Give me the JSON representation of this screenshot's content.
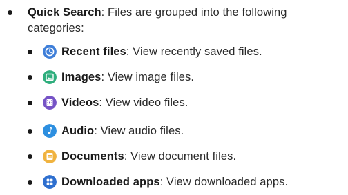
{
  "intro": {
    "title": "Quick Search",
    "line1_rest": ": Files are grouped into the following",
    "line2": "categories:"
  },
  "items": [
    {
      "label": "Recent files",
      "desc": ": View recently saved files.",
      "icon": "clock-icon",
      "color": "#3f7fd9"
    },
    {
      "label": "Images",
      "desc": ": View image files.",
      "icon": "image-icon",
      "color": "#2fae7d"
    },
    {
      "label": "Videos",
      "desc": ": View video files.",
      "icon": "video-icon",
      "color": "#7653c6"
    },
    {
      "label": "Audio",
      "desc": ": View audio files.",
      "icon": "music-note-icon",
      "color": "#2d8fe0"
    },
    {
      "label": "Documents",
      "desc": ": View document files.",
      "icon": "document-icon",
      "color": "#f0b340"
    },
    {
      "label": "Downloaded apps",
      "desc": ": View downloaded apps.",
      "icon": "apps-icon",
      "color": "#2e6fcf"
    }
  ]
}
